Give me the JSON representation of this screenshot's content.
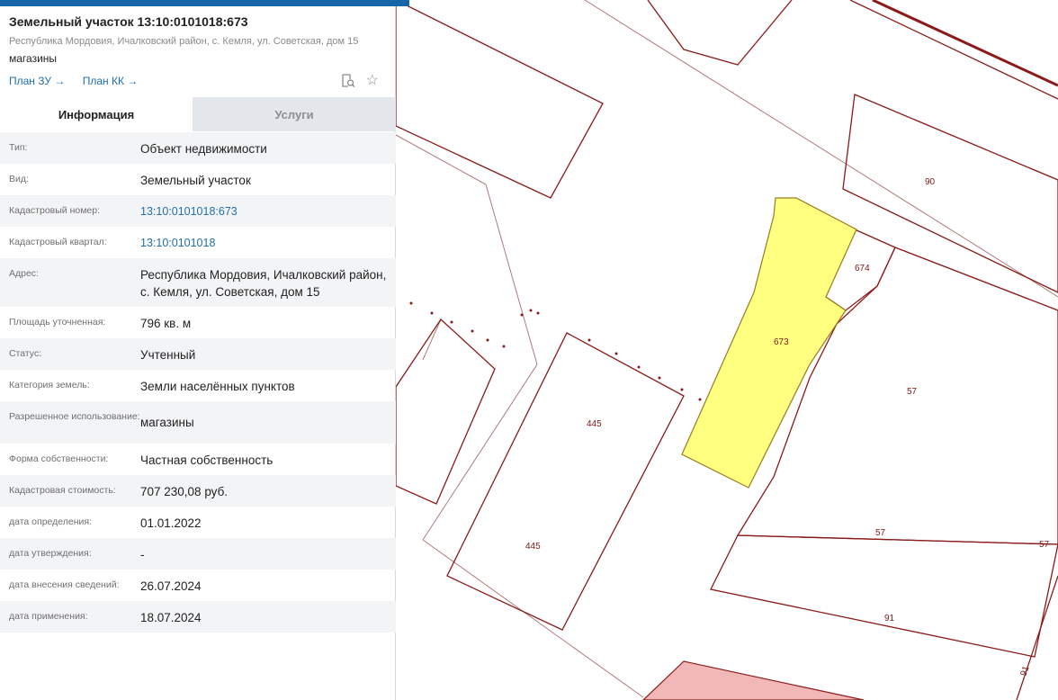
{
  "header": {
    "title": "Земельный участок 13:10:0101018:673",
    "address": "Республика Мордовия, Ичалковский район, с. Кемля, ул. Советская, дом 15",
    "purpose": "магазины",
    "link_plan_zu": "План ЗУ →",
    "link_plan_kk": "План КК →",
    "icons": [
      "search-document-icon",
      "star-icon"
    ]
  },
  "tabs": [
    {
      "label": "Информация",
      "active": true
    },
    {
      "label": "Услуги",
      "active": false
    }
  ],
  "info": [
    {
      "label": "Тип:",
      "value": "Объект недвижимости"
    },
    {
      "label": "Вид:",
      "value": "Земельный участок"
    },
    {
      "label": "Кадастровый номер:",
      "value": "13:10:0101018:673",
      "link": true
    },
    {
      "label": "Кадастровый квартал:",
      "value": "13:10:0101018",
      "link": true
    },
    {
      "label": "Адрес:",
      "value": "Республика Мордовия, Ичалковский район, с. Кемля, ул. Советская, дом 15"
    },
    {
      "label": "Площадь уточненная:",
      "value": "796 кв. м"
    },
    {
      "label": "Статус:",
      "value": "Учтенный"
    },
    {
      "label": "Категория земель:",
      "value": "Земли населённых пунктов"
    },
    {
      "label": "Разрешенное использование:",
      "value": "магазины"
    },
    {
      "label": "Форма собственности:",
      "value": "Частная собственность"
    },
    {
      "label": "Кадастровая стоимость:",
      "value": "707 230,08 руб."
    },
    {
      "label": "дата определения:",
      "value": "01.01.2022"
    },
    {
      "label": "дата утверждения:",
      "value": "-"
    },
    {
      "label": "дата внесения сведений:",
      "value": "26.07.2024"
    },
    {
      "label": "дата применения:",
      "value": "18.07.2024"
    }
  ],
  "map": {
    "labels": {
      "p90": "90",
      "p674": "674",
      "p673": "673",
      "p57a": "57",
      "p445a": "445",
      "p445b": "445",
      "p57b": "57",
      "p57c": "57",
      "p91a": "91",
      "p91b": "91"
    },
    "colors": {
      "boundary": "#8b1a1a",
      "selected_fill": "#ffff80",
      "highlight_fill": "#f2b8b8",
      "accent": "#1565a8"
    }
  }
}
